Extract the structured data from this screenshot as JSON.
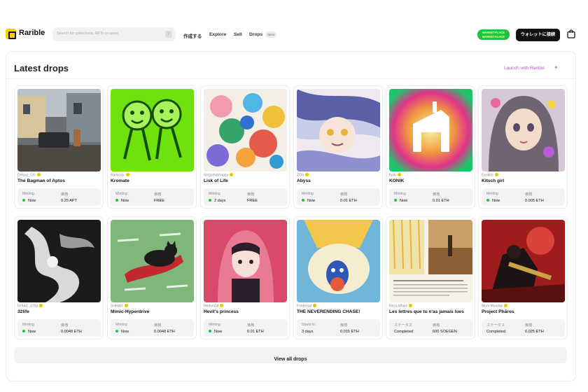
{
  "header": {
    "brand": "Rarible",
    "search_placeholder": "Search for collections, NFTs or users",
    "search_shortcut": "/",
    "nav": [
      "作成する",
      "Explore",
      "Sell",
      "Drops"
    ],
    "new_badge": "NEW",
    "marketplace_line1": "MARKETPLACE",
    "marketplace_line2": "MARKETPLACE",
    "wallet_button": "ウォレットに接続"
  },
  "section": {
    "title": "Latest drops",
    "launch_link": "Launch with Rarible",
    "view_all": "View all drops"
  },
  "drops": [
    {
      "creator": "Deluxz_CG",
      "name": "The Bagman of Aptos",
      "l1": "Minting",
      "v1": "Now",
      "l2": "価格",
      "v2": "0.25 APT",
      "live": true
    },
    {
      "creator": "Ranbock",
      "name": "Kromate",
      "l1": "Minting",
      "v1": "Now",
      "l2": "価格",
      "v2": "FREE",
      "live": true
    },
    {
      "creator": "Singsmilshappy",
      "name": "Lisk of Life",
      "l1": "Minting",
      "v1": "2 days",
      "l2": "価格",
      "v2": "FREE",
      "live": true
    },
    {
      "creator": "ZOS",
      "name": "Abyss",
      "l1": "Minting",
      "v1": "Now",
      "l2": "価格",
      "v2": "0.01 ETH",
      "live": true
    },
    {
      "creator": "hutu",
      "name": "KONIK",
      "l1": "Minting",
      "v1": "Now",
      "l2": "価格",
      "v2": "0.01 ETH",
      "live": true
    },
    {
      "creator": "Exodos",
      "name": "Kitsch girl",
      "l1": "Minting",
      "v1": "Now",
      "l2": "価格",
      "v2": "0.005 ETH",
      "live": true
    },
    {
      "creator": "0×54d...a75d",
      "name": "32life",
      "l1": "Minting",
      "v1": "Now",
      "l2": "価格",
      "v2": "0.0048 ETH",
      "live": true
    },
    {
      "creator": "SHHAN",
      "name": "Mimic-Hyperdrive",
      "l1": "Minting",
      "v1": "Now",
      "l2": "価格",
      "v2": "0.0048 ETH",
      "live": true
    },
    {
      "creator": "Hedoni38",
      "name": "Hevil's princess",
      "l1": "Minting",
      "v1": "Now",
      "l2": "価格",
      "v2": "0.01 ETH",
      "live": true
    },
    {
      "creator": "Fordenad",
      "name": "THE NEVERENDING CHASE!",
      "l1": "Starts in",
      "v1": "3 days",
      "l2": "価格",
      "v2": "0.015 ETH",
      "live": false
    },
    {
      "creator": "Reza Milani",
      "name": "Les lettres que tu n'as jamais lues",
      "l1": "ステータス",
      "v1": "Completed",
      "l2": "価格",
      "v2": "600 SOEGEN",
      "live": false
    },
    {
      "creator": "Mom Monday",
      "name": "Project Phāros",
      "l1": "ステータス",
      "v1": "Completed",
      "l2": "価格",
      "v2": "0.025 ETH",
      "live": false
    }
  ]
}
